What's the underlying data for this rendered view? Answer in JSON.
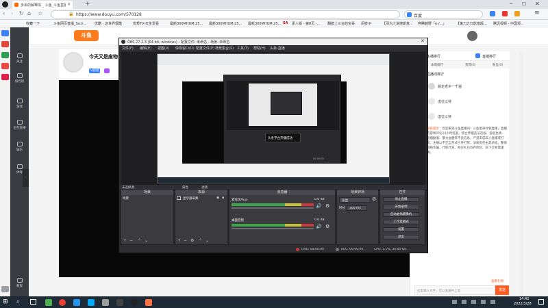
{
  "browser": {
    "tab_title": "多余的解释情 _ 斗鱼_斗鱼直播_主...",
    "new_tab": "+",
    "url": "https://www.douyu.com/570128",
    "search_engine": "百度",
    "bookmarks": [
      "收藏一下",
      "斗鱼网页直播_Sa斗...",
      "优酷 - 这世界很酷",
      "优秀TV-天生爱看",
      "最新300MHUM.25...",
      "最新300MHUM.25...",
      "最新300MHUM.25...",
      "SA",
      "素人版 - 第8页 -...",
      "翻牌上三台的宝哥...",
      "闲技子",
      "【羽为少说搜斯盒...",
      "奔腾越野「e-/...」",
      "【鬼刀之归影南版...",
      "腾讯视频 - 中国领..."
    ]
  },
  "douyu_nav": {
    "items": [
      "关注",
      "排行榜",
      "游戏",
      "正在直播",
      "娱乐",
      "体育"
    ],
    "bottom_item": "教程"
  },
  "room": {
    "title": "今天又是废物",
    "badge_v": "V認證",
    "logo_text": "斗鱼"
  },
  "right_panel": {
    "tabs": [
      "主播排行",
      "本周排行",
      "贵宾(0)",
      "粉丝(0)"
    ],
    "section_title": "直播间排行",
    "share_title": "直播排行",
    "rank_rows": [
      {
        "label": "暴走老乡一千遍"
      },
      {
        "label": "虚位以待"
      },
      {
        "label": "虚位以待"
      }
    ],
    "notice_label": "系统提示：",
    "notice_text": "欢迎来到斗鱼直播间！斗鱼倡导绿色直播，直播内容和评论24小时巡查，禁止传播违法违规、低俗色情、吸烟酗酒、暴力血腥等不良信息，严禁未成年人直播或打赏。主播以不正当方式引导打赏、法律责任由其承担，警惕网络诈骗，代练代充、购买礼包均存风险、私下交易需谨慎。",
    "input_placeholder": "这里输入文字，可以发送并上墙",
    "send_label": "发送",
    "gift_label": "查看礼物"
  },
  "obs": {
    "title": "OBS 27.2.3 (64-bit, windows) - 配置文件: 未命名 - 场景: 未命名",
    "menu": [
      "文件(F)",
      "编辑(E)",
      "视图(V)",
      "停靠窗口(D)",
      "配置文件(P)",
      "场景集合(S)",
      "工具(T)",
      "帮助(H)",
      "头条-直播"
    ],
    "no_source": "未选择源",
    "props_label": "属性",
    "filter_label": "滤镜",
    "docks": {
      "scenes_title": "场景",
      "scene_items": [
        "场景"
      ],
      "sources_title": "来源",
      "source_items": [
        "显示器采集"
      ],
      "mixer_title": "混音器",
      "mixer_tracks": [
        {
          "name": "麦克风/Aux",
          "db": "0.0 dB"
        },
        {
          "name": "桌面音频",
          "db": "0.0 dB"
        }
      ],
      "transitions_title": "场景转场",
      "transition_type": "淡出",
      "duration_label": "时长",
      "duration_value": "300 ms",
      "controls_title": "控件",
      "controls": [
        "停止直播",
        "开始录制",
        "启动虚拟摄像机",
        "工作室模式",
        "设置",
        "退出"
      ]
    },
    "status": {
      "live": "LIVE: 00:00:00",
      "rec": "REC: 00:00:00",
      "cpu": "CPU: 3.1%, 30.00 fps"
    },
    "nested_popup": "头条平台开播成功",
    "nested_time": "00:00:00"
  },
  "taskbar": {
    "time": "14:42",
    "date": "2022/3/28"
  },
  "colors": {
    "obs_bg": "#2a2a2e",
    "douyu_orange": "#ff5d23",
    "meter_green": "#3aa84a",
    "meter_yellow": "#c8c038",
    "meter_red": "#c83838"
  }
}
